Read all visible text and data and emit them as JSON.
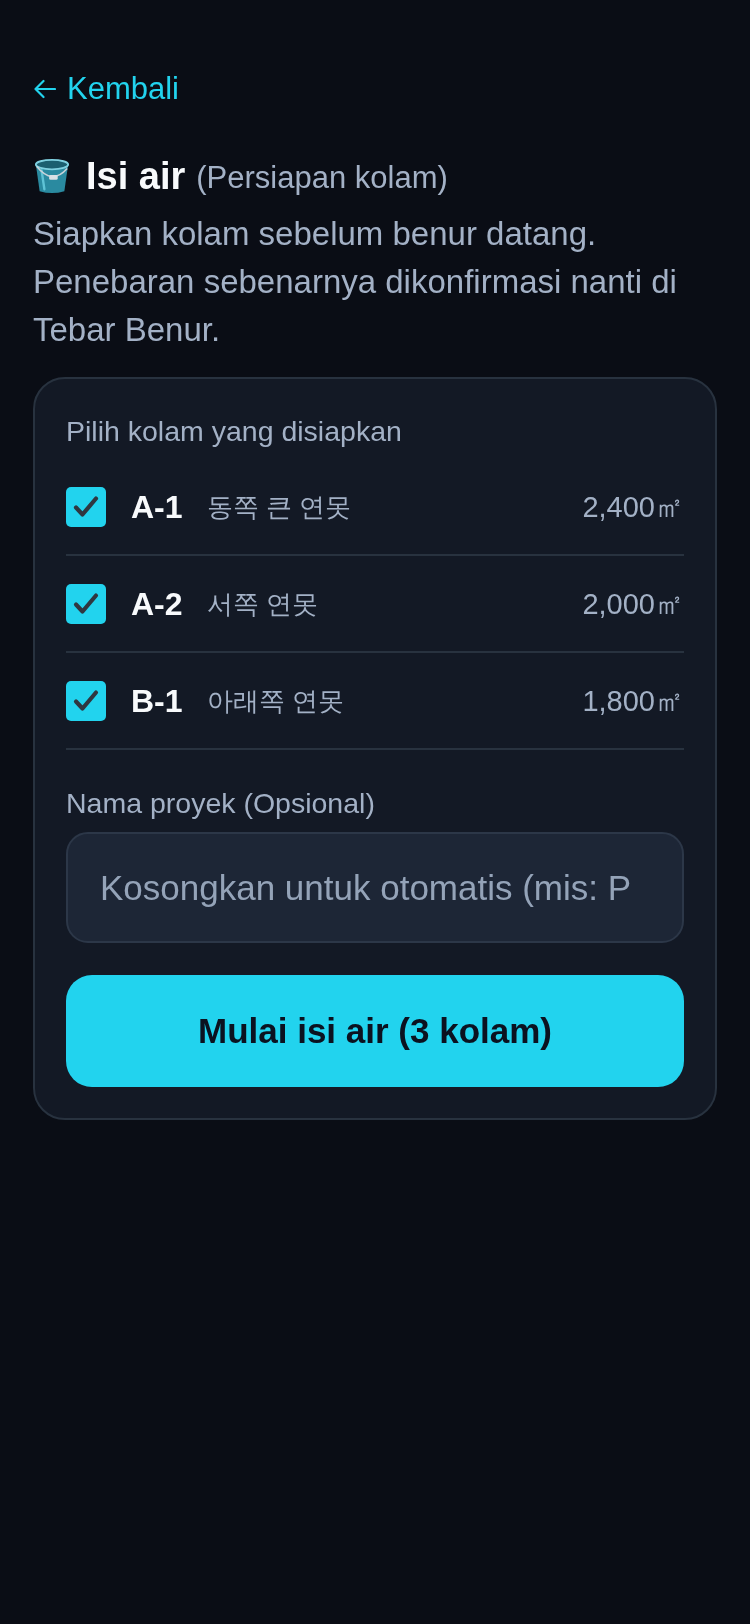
{
  "back_link": {
    "label": "Kembali"
  },
  "header": {
    "title": "Isi air",
    "subtitle": "(Persiapan kolam)",
    "description": "Siapkan kolam sebelum benur datang. Penebaran sebenarnya dikonfirmasi nanti di Tebar Benur."
  },
  "pond_picker": {
    "label": "Pilih kolam yang disiapkan",
    "ponds": [
      {
        "code": "A-1",
        "name": "동쪽 큰 연못",
        "area": "2,400㎡",
        "checked": true
      },
      {
        "code": "A-2",
        "name": "서쪽 연못",
        "area": "2,000㎡",
        "checked": true
      },
      {
        "code": "B-1",
        "name": "아래쪽 연못",
        "area": "1,800㎡",
        "checked": true
      }
    ]
  },
  "project_name": {
    "label": "Nama proyek (Opsional)",
    "placeholder": "Kosongkan untuk otomatis (mis: P"
  },
  "submit_button": {
    "label": "Mulai isi air (3 kolam)"
  }
}
